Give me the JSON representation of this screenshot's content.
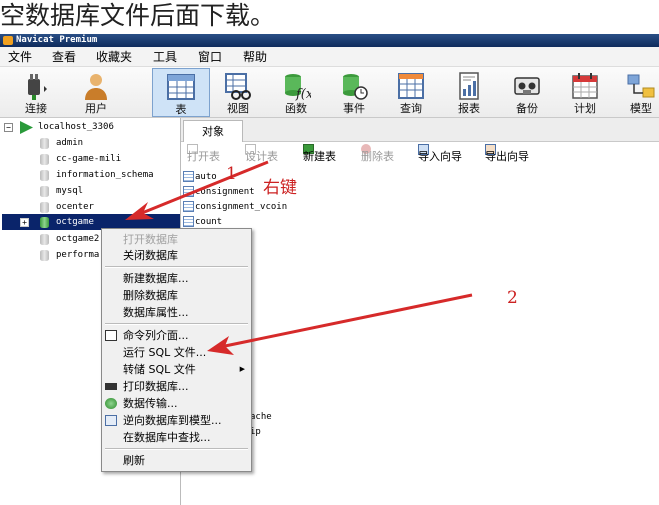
{
  "caption": "空数据库文件后面下载。",
  "window": {
    "title": "Navicat Premium"
  },
  "menubar": [
    "文件",
    "查看",
    "收藏夹",
    "工具",
    "窗口",
    "帮助"
  ],
  "toolbar": [
    {
      "label": "连接",
      "icon": "plug-icon"
    },
    {
      "label": "用户",
      "icon": "user-icon"
    },
    {
      "label": "表",
      "icon": "table-icon",
      "selected": true
    },
    {
      "label": "视图",
      "icon": "view-icon"
    },
    {
      "label": "函数",
      "icon": "function-icon"
    },
    {
      "label": "事件",
      "icon": "event-icon"
    },
    {
      "label": "查询",
      "icon": "query-icon"
    },
    {
      "label": "报表",
      "icon": "report-icon"
    },
    {
      "label": "备份",
      "icon": "backup-icon"
    },
    {
      "label": "计划",
      "icon": "schedule-icon"
    },
    {
      "label": "模型",
      "icon": "model-icon"
    }
  ],
  "tree": {
    "connection": "localhost_3306",
    "databases": [
      "admin",
      "cc-game-mili",
      "information_schema",
      "mysql",
      "ocenter",
      "octgame",
      "octgame2",
      "performa"
    ],
    "selected": "octgame"
  },
  "object_tab": "对象",
  "object_toolbar": [
    {
      "label": "打开表",
      "enabled": false
    },
    {
      "label": "设计表",
      "enabled": false
    },
    {
      "label": "新建表",
      "enabled": true
    },
    {
      "label": "删除表",
      "enabled": false
    },
    {
      "label": "导入向导",
      "enabled": true
    },
    {
      "label": "导出向导",
      "enabled": true
    }
  ],
  "tables": [
    "auto",
    "consignment",
    "consignment_vcoin",
    "count"
  ],
  "tables_partial": [
    "ache",
    "ip"
  ],
  "context_menu": {
    "items": [
      {
        "label": "打开数据库",
        "enabled": false
      },
      {
        "label": "关闭数据库",
        "enabled": true
      },
      {
        "label": "新建数据库...",
        "enabled": true
      },
      {
        "label": "删除数据库",
        "enabled": true
      },
      {
        "label": "数据库属性...",
        "enabled": true
      },
      {
        "label": "命令列介面...",
        "enabled": true,
        "icon": "console-icon"
      },
      {
        "label": "运行 SQL 文件...",
        "enabled": true
      },
      {
        "label": "转储 SQL 文件",
        "enabled": true,
        "submenu": true
      },
      {
        "label": "打印数据库...",
        "enabled": true,
        "icon": "printer-icon"
      },
      {
        "label": "数据传输...",
        "enabled": true,
        "icon": "transfer-icon"
      },
      {
        "label": "逆向数据库到模型...",
        "enabled": true,
        "icon": "model-icon"
      },
      {
        "label": "在数据库中查找...",
        "enabled": true
      },
      {
        "label": "刷新",
        "enabled": true
      }
    ],
    "submenu_arrow": "▶"
  },
  "annotations": {
    "one": "1",
    "right_click": "右键",
    "two": "2"
  },
  "colors": {
    "arrow": "#d62a2a",
    "selection": "#0a246a"
  }
}
